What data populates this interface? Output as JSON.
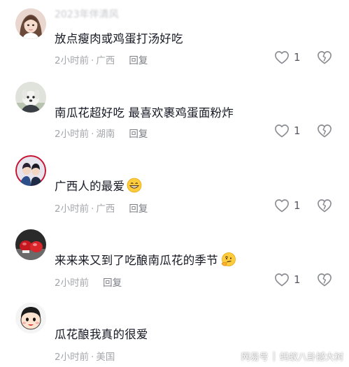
{
  "comments": [
    {
      "username": "2023年伴清风",
      "text": "放点瘦肉或鸡蛋打汤好吃",
      "time": "2小时前",
      "location": "广西",
      "reply_label": "回复",
      "likes": "1",
      "emoji": ""
    },
    {
      "username": "",
      "text": "南瓜花超好吃 最喜欢裹鸡蛋面粉炸",
      "time": "2小时前",
      "location": "湖南",
      "reply_label": "回复",
      "likes": "1",
      "emoji": ""
    },
    {
      "username": "",
      "text": "广西人的最爱",
      "time": "2小时前",
      "location": "广西",
      "reply_label": "回复",
      "likes": "1",
      "emoji": "grinning-face-icon"
    },
    {
      "username": "",
      "text": "来来来又到了吃酿南瓜花的季节",
      "time": "2小时前",
      "location": "",
      "reply_label": "回复",
      "likes": "1",
      "emoji": "thinking-face-icon"
    },
    {
      "username": "",
      "text": "瓜花酿我真的很爱",
      "time": "2小时前",
      "location": "美国",
      "reply_label": "回复",
      "likes": "",
      "emoji": ""
    }
  ],
  "watermark": {
    "platform": "网易号",
    "separator": "|",
    "author": "蚂蚁八卦撼大树"
  },
  "colors": {
    "text": "#161823",
    "meta": "#a4a6ab",
    "reply": "#7b7d84",
    "icon": "#8a8c92"
  }
}
